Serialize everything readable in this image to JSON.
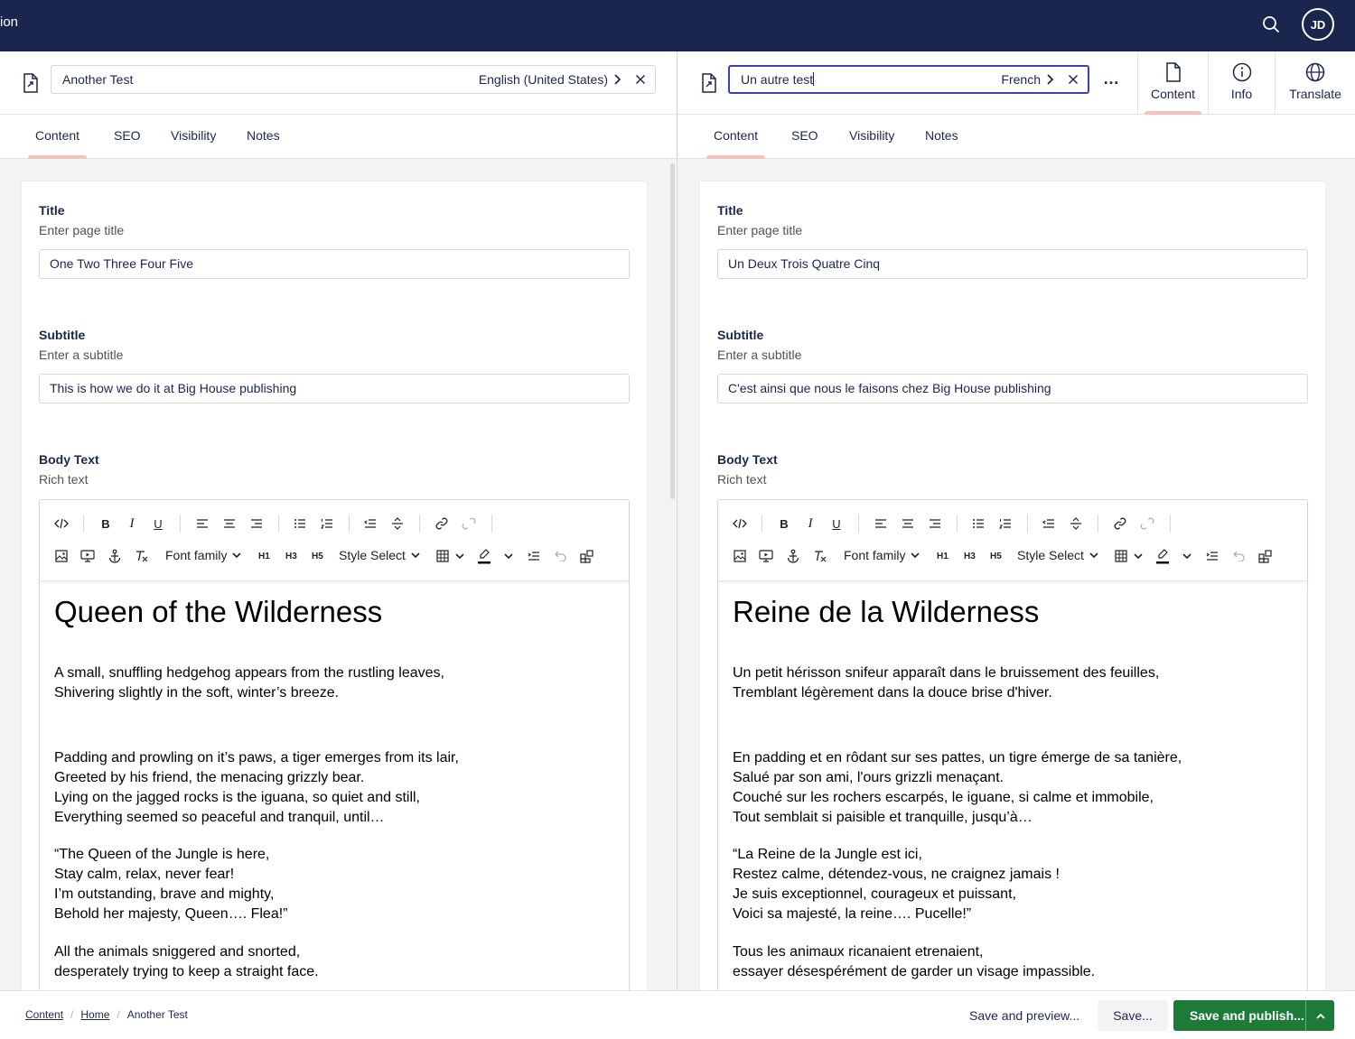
{
  "topbar": {
    "app_label": "ion",
    "avatar_initials": "JD",
    "search_icon": "search-icon"
  },
  "left": {
    "name": "Another Test",
    "language": "English (United States)",
    "tabs": [
      {
        "label": "Content",
        "active": true
      },
      {
        "label": "SEO"
      },
      {
        "label": "Visibility"
      },
      {
        "label": "Notes"
      }
    ],
    "title_label": "Title",
    "title_desc": "Enter page title",
    "title_value": "One Two Three Four Five",
    "subtitle_label": "Subtitle",
    "subtitle_desc": "Enter a subtitle",
    "subtitle_value": "This is how we do it at Big House publishing",
    "body_label": "Body Text",
    "body_desc": "Rich text",
    "heading": "Queen of the Wilderness",
    "paragraphs": [
      "A small, snuffling hedgehog appears from the rustling leaves,",
      "Shivering slightly in the soft, winter’s breeze.",
      "Padding and prowling on it’s paws, a tiger emerges from its lair,",
      "Greeted by his friend, the menacing grizzly bear.",
      "Lying on the jagged rocks is the iguana, so quiet and still,",
      "Everything seemed so peaceful and tranquil, until…",
      "“The Queen of the Jungle is here,",
      "Stay calm, relax, never fear!",
      "I’m outstanding, brave and mighty,",
      "Behold her majesty, Queen…. Flea!”",
      "All the animals sniggered and snorted,",
      "desperately trying to keep a straight face."
    ]
  },
  "right": {
    "name": "Un autre test",
    "language": "French",
    "more_label": "…",
    "app_tabs": [
      {
        "label": "Content",
        "icon": "document-icon",
        "active": true
      },
      {
        "label": "Info",
        "icon": "info-icon"
      },
      {
        "label": "Translate",
        "icon": "globe-icon"
      }
    ],
    "tabs": [
      {
        "label": "Content",
        "active": true
      },
      {
        "label": "SEO"
      },
      {
        "label": "Visibility"
      },
      {
        "label": "Notes"
      }
    ],
    "title_label": "Title",
    "title_desc": "Enter page title",
    "title_value": "Un Deux Trois Quatre Cinq",
    "subtitle_label": "Subtitle",
    "subtitle_desc": "Enter a subtitle",
    "subtitle_value": "C'est ainsi que nous le faisons chez Big House publishing",
    "body_label": "Body Text",
    "body_desc": "Rich text",
    "heading": "Reine de la Wilderness",
    "paragraphs": [
      "Un petit hérisson snifeur apparaît dans le bruissement des feuilles,",
      "Tremblant légèrement dans la douce brise d'hiver.",
      "En padding et en rôdant sur ses pattes, un tigre émerge de sa tanière,",
      "Salué par son ami, l'ours grizzli menaçant.",
      "Couché sur les rochers escarpés, le iguane, si calme et immobile,",
      "Tout semblait si paisible et tranquille, jusqu’à…",
      "“La Reine de la Jungle est ici,",
      "Restez calme, détendez-vous, ne craignez jamais !",
      "Je suis exceptionnel, courageux et puissant,",
      "Voici sa majesté, la reine…. Pucelle!”",
      "Tous les animaux ricanaient etrenaient,",
      "essayer désespérément de garder un visage impassible."
    ]
  },
  "toolbar": {
    "font_family": "Font family",
    "style_select": "Style Select",
    "h1": "H1",
    "h3": "H3",
    "h5": "H5"
  },
  "bottom": {
    "breadcrumb": [
      "Content",
      "Home",
      "Another Test"
    ],
    "save_preview": "Save and preview...",
    "save": "Save...",
    "save_publish": "Save and publish..."
  },
  "colors": {
    "topbar": "#1b264f",
    "accent_tab": "#f5c1bc",
    "publish": "#1f7a3a",
    "focus": "#3544b1"
  }
}
